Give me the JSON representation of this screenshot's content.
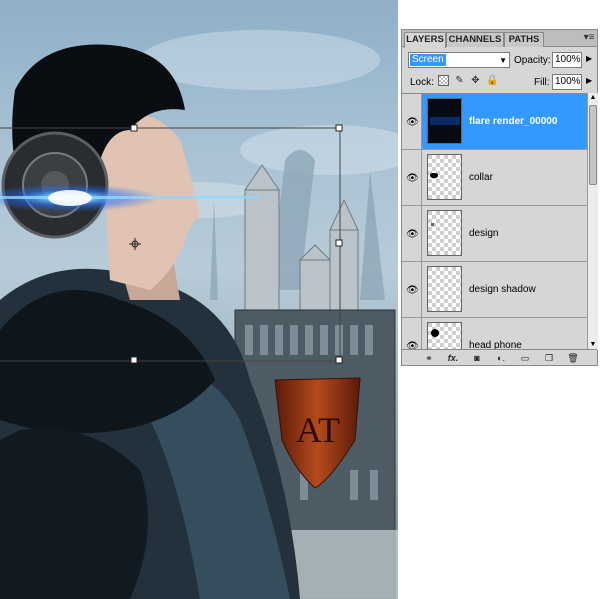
{
  "panel": {
    "tabs": [
      {
        "label": "LAYERS",
        "active": true
      },
      {
        "label": "CHANNELS",
        "active": false
      },
      {
        "label": "PATHS",
        "active": false
      }
    ],
    "menu_icon": "panel-menu-icon",
    "blend_mode": "Screen",
    "opacity_label": "Opacity:",
    "opacity_value": "100%",
    "lock_label": "Lock:",
    "fill_label": "Fill:",
    "fill_value": "100%",
    "layers": [
      {
        "name": "flare render_00000",
        "selected": true,
        "visible": true
      },
      {
        "name": "collar",
        "selected": false,
        "visible": true
      },
      {
        "name": "design",
        "selected": false,
        "visible": true
      },
      {
        "name": "design shadow",
        "selected": false,
        "visible": true
      },
      {
        "name": "head phone",
        "selected": false,
        "visible": true
      }
    ],
    "bottom_icons": [
      "link-icon",
      "fx-icon",
      "mask-icon",
      "adjustment-icon",
      "group-icon",
      "new-layer-icon",
      "trash-icon"
    ]
  },
  "colors": {
    "selection": "#3399ff",
    "panel_bg": "#d6d6d6",
    "flare": "#1e90ff",
    "shield": "#8a2e12"
  },
  "canvas": {
    "shield_text": "AT"
  }
}
